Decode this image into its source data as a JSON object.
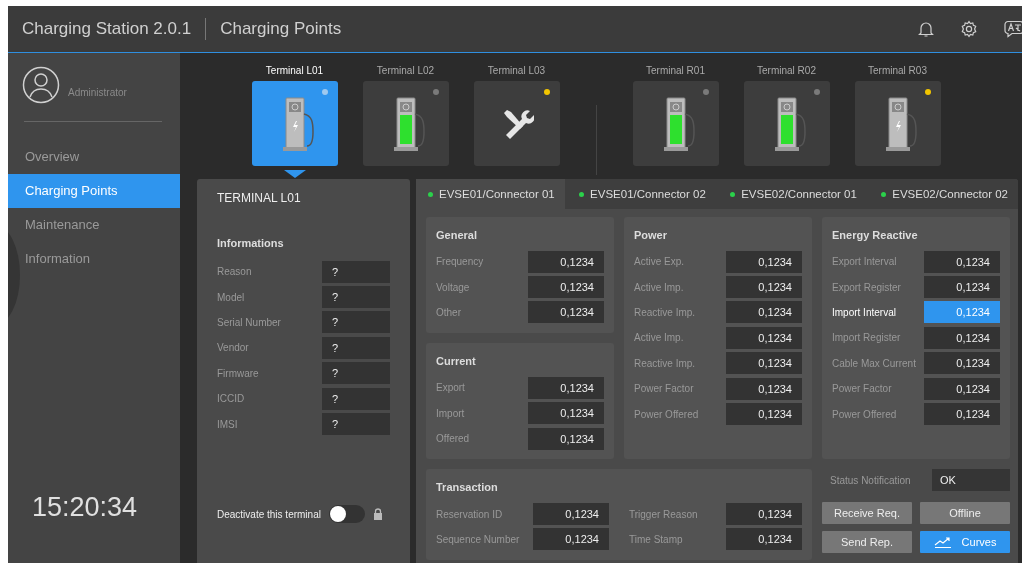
{
  "window": {
    "app_title": "Charging Station 2.0.1",
    "page_title": "Charging Points"
  },
  "user": {
    "name": "Administrator"
  },
  "sidebar": {
    "items": [
      {
        "label": "Overview",
        "selected": false
      },
      {
        "label": "Charging Points",
        "selected": true
      },
      {
        "label": "Maintenance",
        "selected": false
      },
      {
        "label": "Information",
        "selected": false
      }
    ],
    "clock": "15:20:34"
  },
  "terminal_groups": [
    [
      {
        "label": "Terminal L01",
        "kind": "charger",
        "selected": true,
        "charging": false,
        "color": "#9fc9ef"
      },
      {
        "label": "Terminal L02",
        "kind": "charger",
        "selected": false,
        "charging": true,
        "color": "#7a7a7a"
      },
      {
        "label": "Terminal L03",
        "kind": "maintenance",
        "selected": false,
        "color": "#f2c500"
      }
    ],
    [
      {
        "label": "Terminal R01",
        "kind": "charger",
        "selected": false,
        "charging": true,
        "color": "#7a7a7a"
      },
      {
        "label": "Terminal R02",
        "kind": "charger",
        "selected": false,
        "charging": true,
        "color": "#7a7a7a"
      },
      {
        "label": "Terminal R03",
        "kind": "charger",
        "selected": false,
        "charging": false,
        "color": "#f2c500"
      }
    ]
  ],
  "terminal_panel": {
    "title": "TERMINAL L01",
    "section": "Informations",
    "fields": [
      {
        "label": "Reason",
        "value": "?"
      },
      {
        "label": "Model",
        "value": "?"
      },
      {
        "label": "Serial Number",
        "value": "?"
      },
      {
        "label": "Vendor",
        "value": "?"
      },
      {
        "label": "Firmware",
        "value": "?"
      },
      {
        "label": "ICCID",
        "value": "?"
      },
      {
        "label": "IMSI",
        "value": "?"
      }
    ],
    "deactivate": {
      "label": "Deactivate this terminal",
      "on": false,
      "locked": true
    }
  },
  "connector_tabs": [
    {
      "label": "EVSE01/Connector 01",
      "selected": true
    },
    {
      "label": "EVSE01/Connector 02",
      "selected": false
    },
    {
      "label": "EVSE02/Connector 01",
      "selected": false
    },
    {
      "label": "EVSE02/Connector 02",
      "selected": false
    }
  ],
  "sections": [
    {
      "title": "General",
      "rows": [
        {
          "label": "Frequency",
          "value": "0,1234",
          "selected": false
        },
        {
          "label": "Voltage",
          "value": "0,1234",
          "selected": false
        },
        {
          "label": "Other",
          "value": "0,1234",
          "selected": false
        }
      ]
    },
    {
      "title": "Current",
      "rows": [
        {
          "label": "Export",
          "value": "0,1234",
          "selected": false
        },
        {
          "label": "Import",
          "value": "0,1234",
          "selected": false
        },
        {
          "label": "Offered",
          "value": "0,1234",
          "selected": false
        }
      ]
    },
    {
      "title": "Power",
      "rows": [
        {
          "label": "Active Exp.",
          "value": "0,1234",
          "selected": false
        },
        {
          "label": "Active Imp.",
          "value": "0,1234",
          "selected": false
        },
        {
          "label": "Reactive Imp.",
          "value": "0,1234",
          "selected": false
        },
        {
          "label": "Active Imp.",
          "value": "0,1234",
          "selected": false
        },
        {
          "label": "Reactive Imp.",
          "value": "0,1234",
          "selected": false
        },
        {
          "label": "Power Factor",
          "value": "0,1234",
          "selected": false
        },
        {
          "label": "Power Offered",
          "value": "0,1234",
          "selected": false
        }
      ]
    },
    {
      "title": "Energy Reactive",
      "rows": [
        {
          "label": "Export Interval",
          "value": "0,1234",
          "selected": false
        },
        {
          "label": "Export Register",
          "value": "0,1234",
          "selected": false
        },
        {
          "label": "Import Interval",
          "value": "0,1234",
          "selected": true
        },
        {
          "label": "Import Register",
          "value": "0,1234",
          "selected": false
        },
        {
          "label": "Cable Max Current",
          "value": "0,1234",
          "selected": false
        },
        {
          "label": "Power Factor",
          "value": "0,1234",
          "selected": false
        },
        {
          "label": "Power Offered",
          "value": "0,1234",
          "selected": false
        }
      ]
    },
    {
      "title": "Transaction",
      "rows": [
        {
          "label": "Reservation ID",
          "value": "0,1234",
          "selected": false
        },
        {
          "label": "Sequence Number",
          "value": "0,1234",
          "selected": false
        },
        {
          "label": "Trigger Reason",
          "value": "0,1234",
          "selected": false
        },
        {
          "label": "Time Stamp",
          "value": "0,1234",
          "selected": false
        }
      ]
    }
  ],
  "status_notification": {
    "label": "Status Notification",
    "value": "OK"
  },
  "buttons": [
    {
      "label": "Receive Req.",
      "kind": "secondary"
    },
    {
      "label": "Offline",
      "kind": "secondary"
    },
    {
      "label": "Send Rep.",
      "kind": "secondary"
    },
    {
      "label": "Curves",
      "kind": "primary"
    }
  ]
}
